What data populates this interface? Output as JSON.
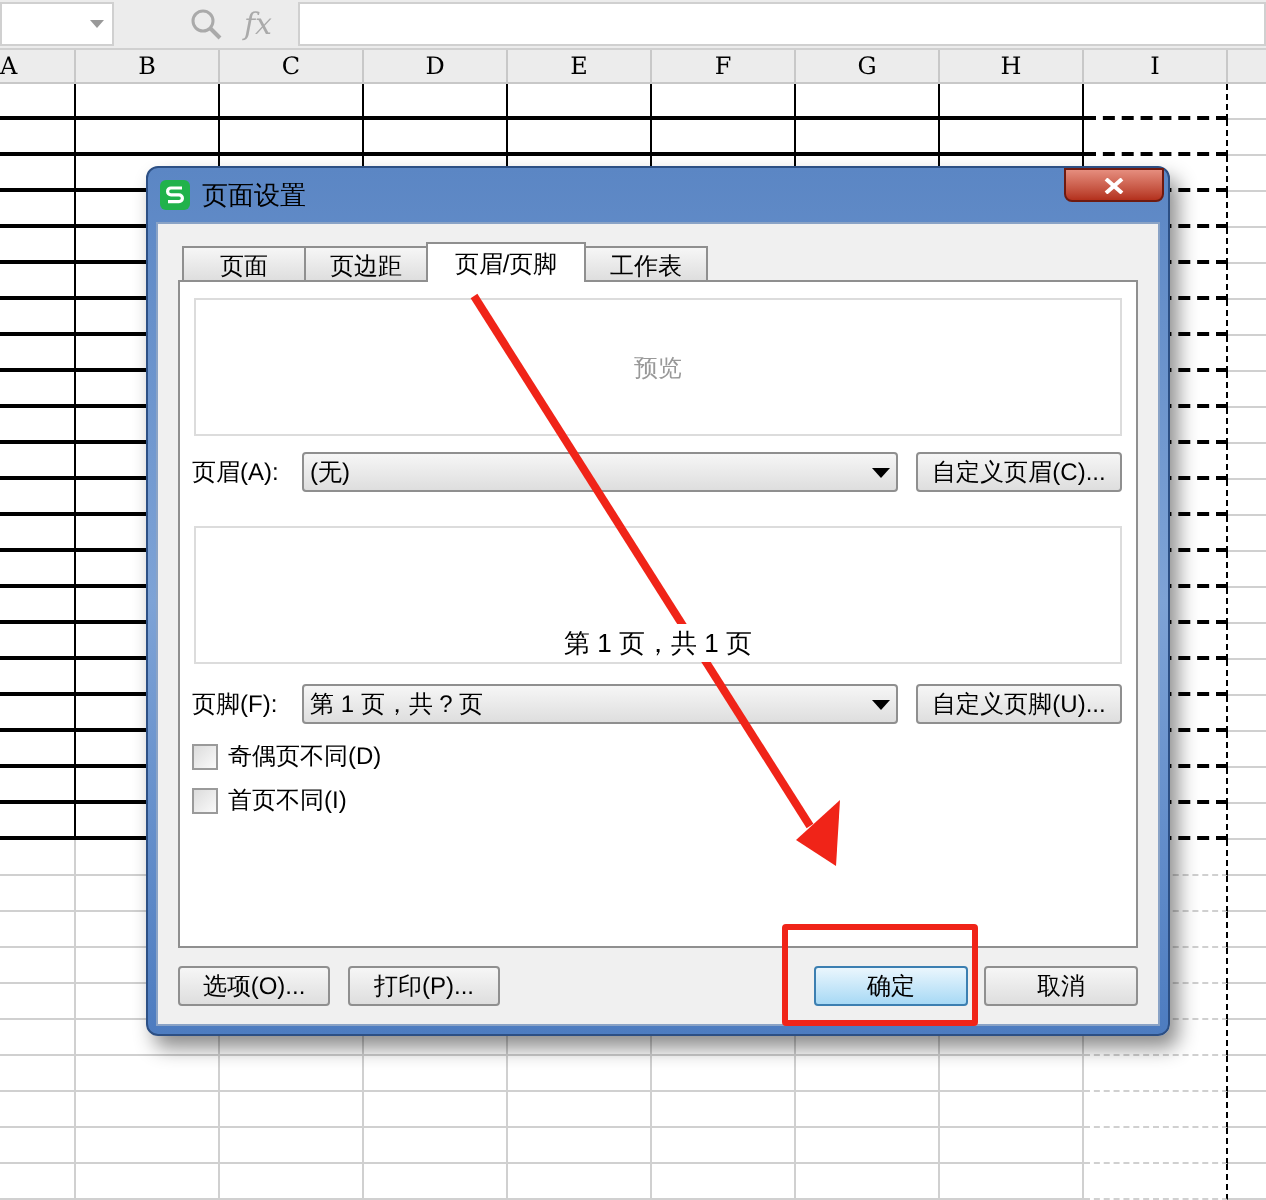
{
  "formula_bar": {
    "function_label": "fx"
  },
  "columns": [
    "A",
    "B",
    "C",
    "D",
    "E",
    "F",
    "G",
    "H",
    "I"
  ],
  "dialog": {
    "title": "页面设置",
    "tabs": [
      {
        "label": "页面",
        "selected": false
      },
      {
        "label": "页边距",
        "selected": false
      },
      {
        "label": "页眉/页脚",
        "selected": true
      },
      {
        "label": "工作表",
        "selected": false
      }
    ],
    "header_preview": {
      "text": "预览"
    },
    "header": {
      "label": "页眉(A):",
      "value": "(无)",
      "button": "自定义页眉(C)..."
    },
    "footer_preview": {
      "text": "第 1 页，共 1 页"
    },
    "footer": {
      "label": "页脚(F):",
      "value": "第 1 页，共 ? 页",
      "button": "自定义页脚(U)..."
    },
    "checkboxes": [
      {
        "label": "奇偶页不同(D)",
        "checked": false
      },
      {
        "label": "首页不同(I)",
        "checked": false
      }
    ],
    "left_buttons": [
      "选项(O)...",
      "打印(P)..."
    ],
    "right_buttons": [
      {
        "label": "确定",
        "default": true
      },
      {
        "label": "取消",
        "default": false
      }
    ]
  }
}
